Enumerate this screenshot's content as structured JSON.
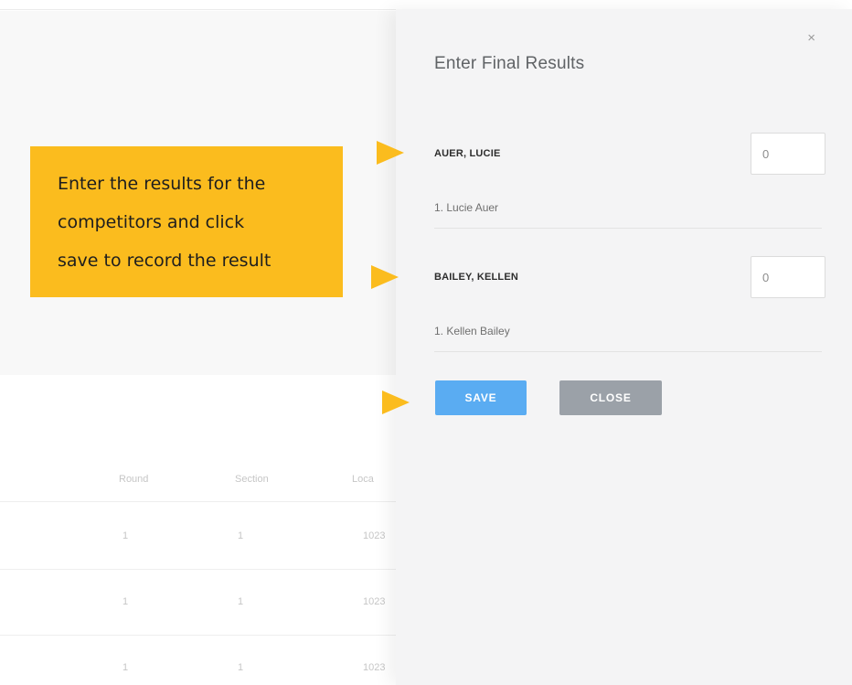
{
  "background_table": {
    "headers": [
      "Round",
      "Section",
      "Loca"
    ],
    "rows": [
      [
        "1",
        "1",
        "1023"
      ],
      [
        "1",
        "1",
        "1023"
      ],
      [
        "1",
        "1",
        "1023"
      ]
    ]
  },
  "callout": {
    "lines": [
      "Enter the results for the",
      "competitors and click",
      "save to record the result"
    ]
  },
  "dialog": {
    "title": "Enter Final Results",
    "close_icon": "×",
    "entries": [
      {
        "name": "AUER, LUCIE",
        "value": "0",
        "member": "1. Lucie Auer"
      },
      {
        "name": "BAILEY, KELLEN",
        "value": "0",
        "member": "1. Kellen Bailey"
      }
    ],
    "save_label": "SAVE",
    "close_label": "CLOSE"
  },
  "colors": {
    "callout": "#fbbc1e",
    "save_button": "#5aacf2",
    "close_button": "#9ba1a8",
    "panel": "#f4f4f5"
  }
}
